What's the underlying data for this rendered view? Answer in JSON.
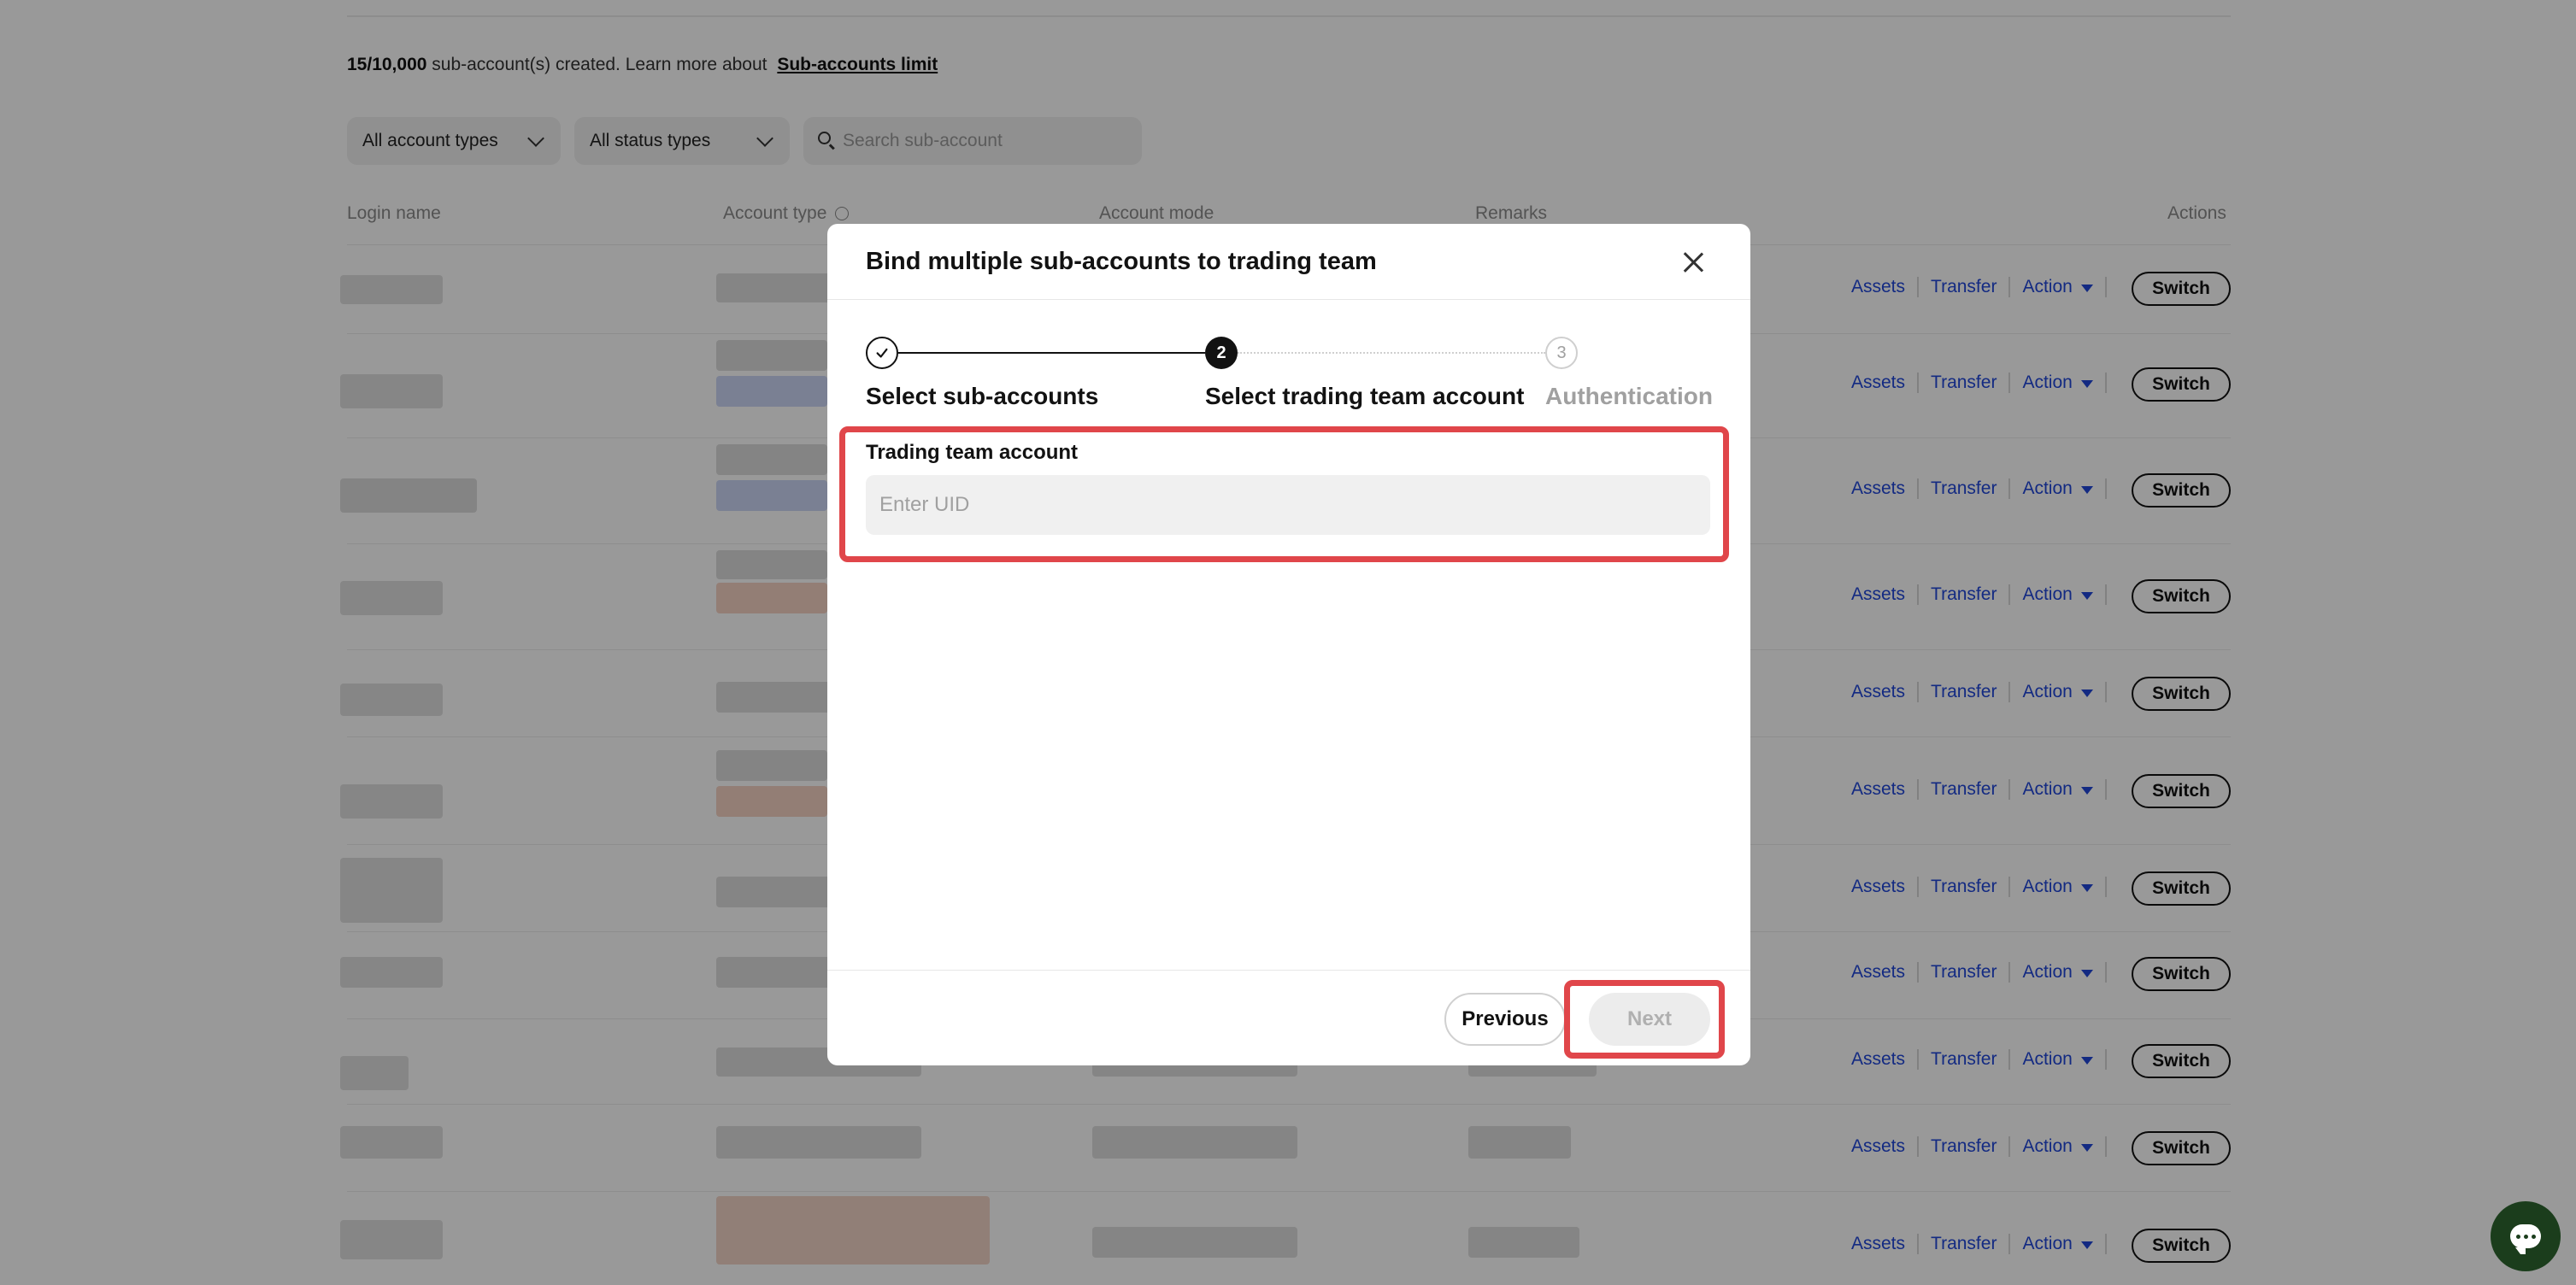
{
  "page": {
    "limit_count": "15/10,000",
    "limit_text": "sub-account(s) created. Learn more about",
    "limit_link": "Sub-accounts limit",
    "filters": {
      "account_types": "All account types",
      "status_types": "All status types"
    },
    "search": {
      "placeholder": "Search sub-account"
    },
    "columns": {
      "login_name": "Login name",
      "account_type": "Account type",
      "account_mode": "Account mode",
      "remarks": "Remarks",
      "actions": "Actions"
    },
    "row_actions": {
      "assets": "Assets",
      "transfer": "Transfer",
      "action": "Action",
      "switch": "Switch"
    }
  },
  "modal": {
    "title": "Bind multiple sub-accounts to trading team",
    "steps": [
      {
        "number": "1",
        "label": "Select sub-accounts",
        "state": "completed"
      },
      {
        "number": "2",
        "label": "Select trading team account",
        "state": "active"
      },
      {
        "number": "3",
        "label": "Authentication",
        "state": "pending"
      }
    ],
    "field_label": "Trading team account",
    "input": {
      "placeholder": "Enter UID",
      "value": ""
    },
    "previous_label": "Previous",
    "next_label": "Next"
  },
  "colors": {
    "accent_link": "#2147d9",
    "highlight": "#e0464a",
    "chat_button": "#1b3d1c"
  },
  "icons": {
    "close": "close-icon",
    "step_done": "check-icon",
    "search": "search-icon",
    "chat": "chat-icon"
  }
}
